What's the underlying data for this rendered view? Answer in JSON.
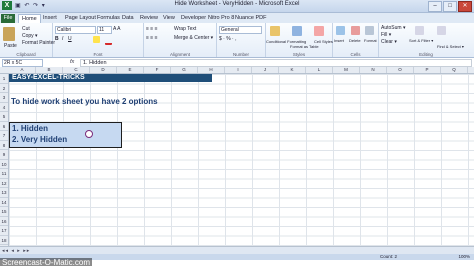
{
  "window": {
    "title": "Hide Worksheet - VeryHidden - Microsoft Excel",
    "qat": "▣ ↶ ↷ ▾"
  },
  "ribbon_tabs": [
    "File",
    "Home",
    "Insert",
    "Page Layout",
    "Formulas",
    "Data",
    "Review",
    "View",
    "Developer",
    "Nitro Pro 8",
    "Nuance PDF"
  ],
  "ribbon": {
    "clipboard": {
      "cut": "Cut",
      "copy": "Copy ▾",
      "format_painter": "Format Painter",
      "paste": "Paste",
      "group": "Clipboard"
    },
    "font": {
      "name": "Calibri",
      "size": "11",
      "group": "Font"
    },
    "alignment": {
      "wrap": "Wrap Text",
      "merge": "Merge & Center ▾",
      "group": "Alignment"
    },
    "number": {
      "format": "General",
      "group": "Number"
    },
    "styles": {
      "conditional": "Conditional Formatting",
      "format_table": "Format as Table",
      "cell_styles": "Cell Styles",
      "group": "Styles"
    },
    "cells": {
      "insert": "Insert",
      "delete": "Delete",
      "format": "Format",
      "group": "Cells"
    },
    "editing": {
      "autosum": "AutoSum ▾",
      "fill": "Fill ▾",
      "clear": "Clear ▾",
      "sort": "Sort & Filter ▾",
      "find": "Find & Select ▾",
      "group": "Editing"
    }
  },
  "formula_bar": {
    "name_box": "2R x 5C",
    "fx": "fx",
    "formula": "1. Hidden"
  },
  "columns": [
    "A",
    "B",
    "C",
    "D",
    "E",
    "F",
    "G",
    "H",
    "I",
    "J",
    "K",
    "L",
    "M",
    "N",
    "O",
    "P",
    "Q"
  ],
  "rows": [
    "1",
    "2",
    "3",
    "4",
    "5",
    "6",
    "7",
    "8",
    "9",
    "10",
    "11",
    "12",
    "13",
    "14",
    "15",
    "16",
    "17",
    "18"
  ],
  "sheet": {
    "banner": "EASY-EXCEL-TRICKS",
    "subtitle": "To hide work sheet you have 2 options",
    "option1": "1. Hidden",
    "option2": "2. Very Hidden"
  },
  "status": {
    "count": "Count: 2",
    "zoom": "100%"
  },
  "watermark": "Screencast-O-Matic.com",
  "colors": {
    "banner": "#1f4e79",
    "selection_fill": "#c6d9f1",
    "text_blue": "#1f3f73",
    "file_tab": "#2a6b39"
  }
}
